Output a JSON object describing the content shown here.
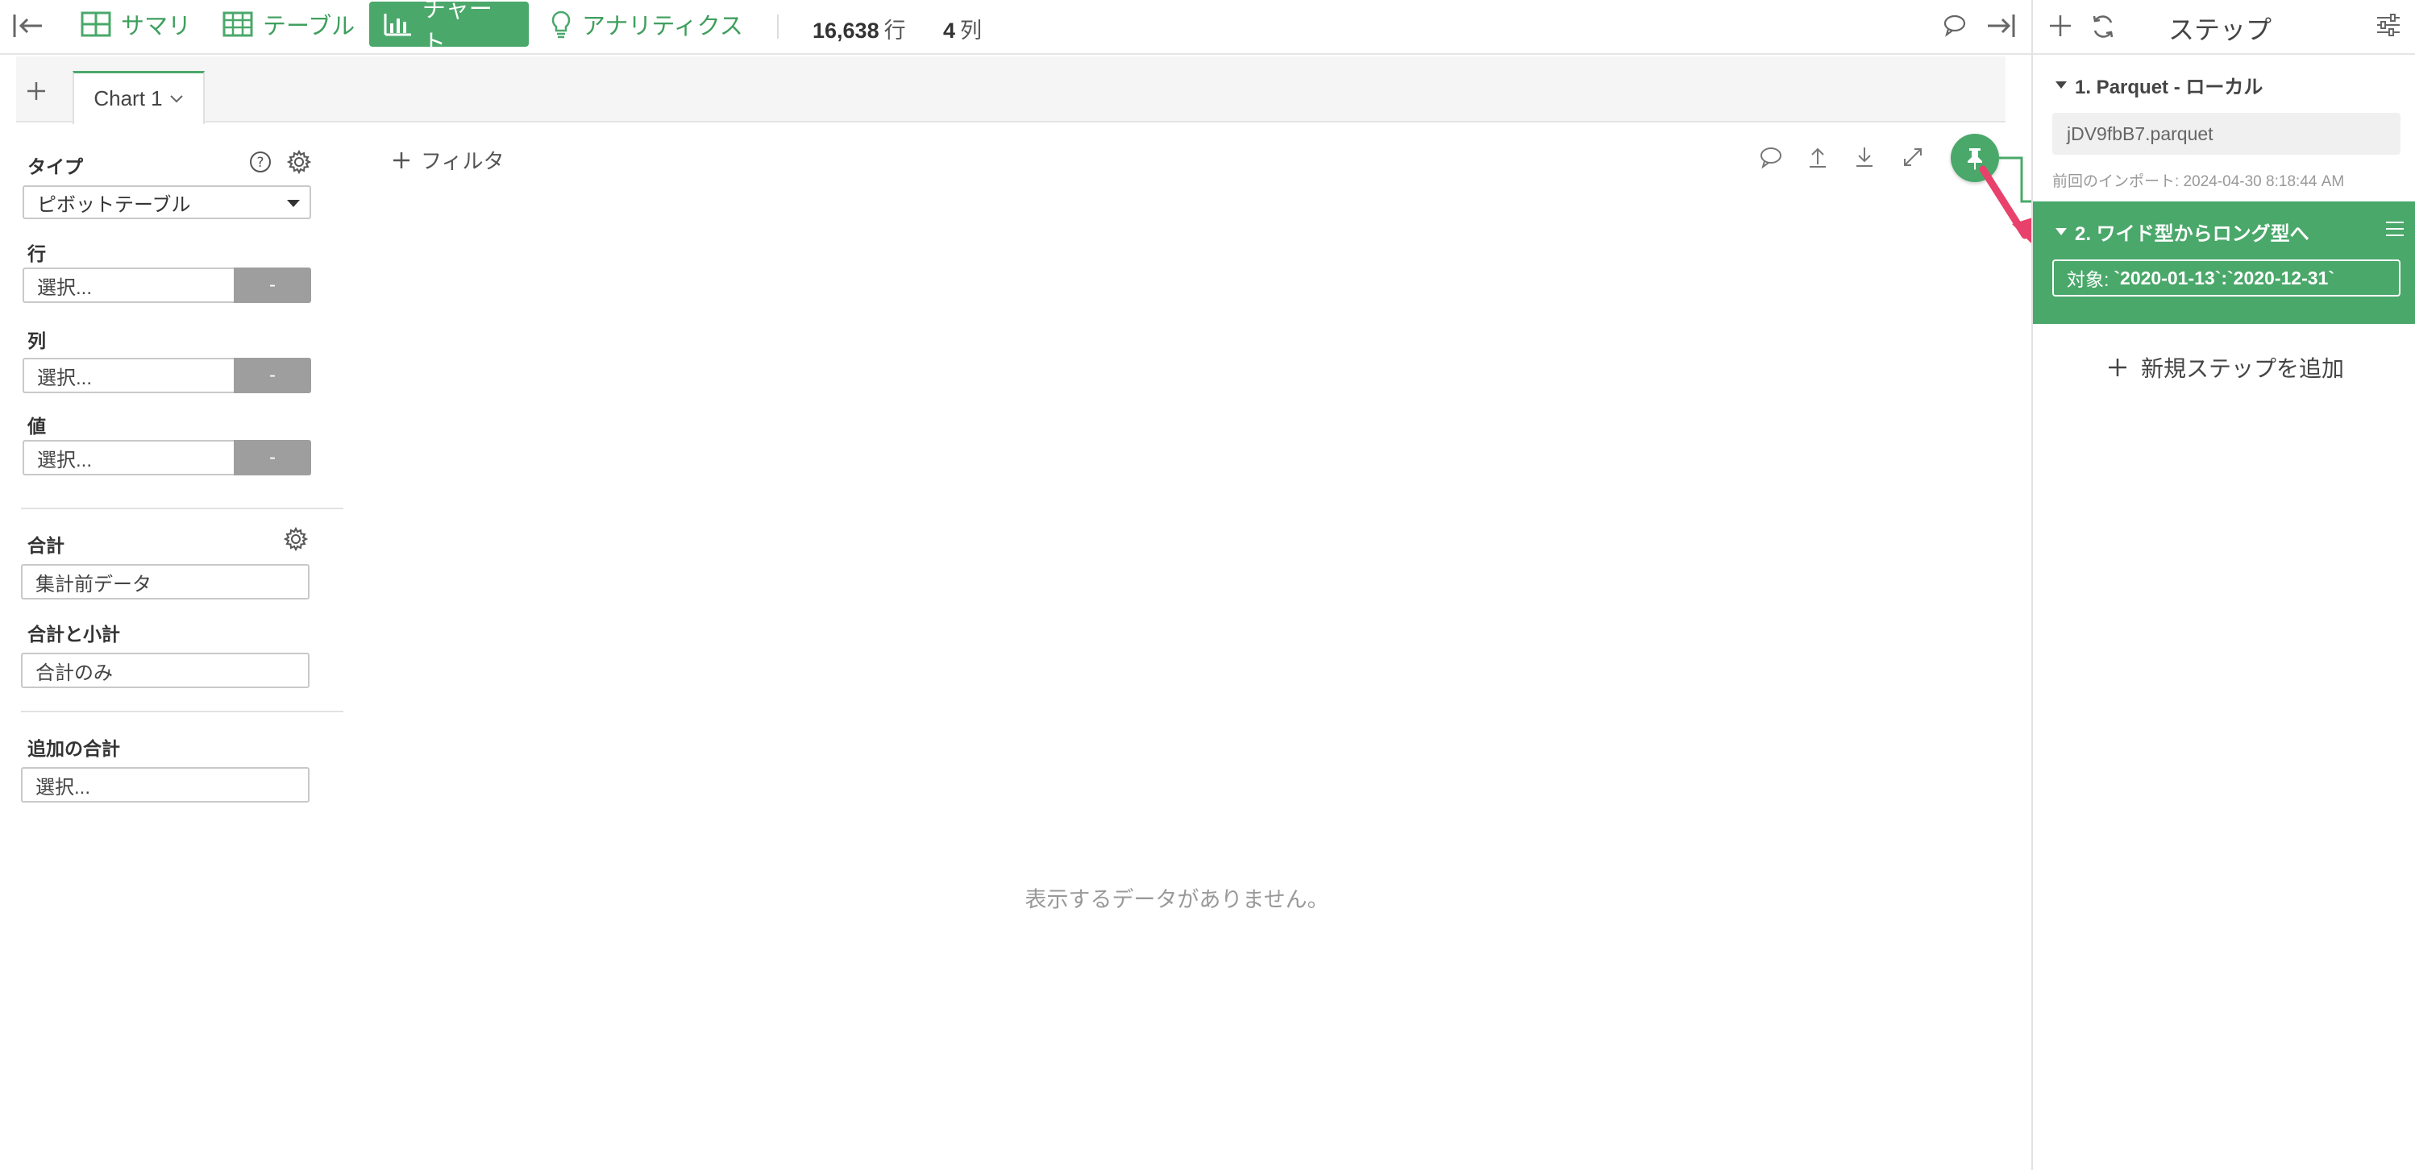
{
  "topbar": {
    "tabs": [
      {
        "label": "サマリ",
        "icon": "grid-icon"
      },
      {
        "label": "テーブル",
        "icon": "table-icon"
      },
      {
        "label": "チャート",
        "icon": "bar-chart-icon",
        "active": true
      },
      {
        "label": "アナリティクス",
        "icon": "lightbulb-icon"
      }
    ],
    "rows_count": "16,638",
    "rows_unit": "行",
    "cols_count": "4",
    "cols_unit": "列"
  },
  "chart_tabs": {
    "current": "Chart 1"
  },
  "config": {
    "type_label": "タイプ",
    "type_value": "ピボットテーブル",
    "rows_label": "行",
    "rows_placeholder": "選択...",
    "cols_label": "列",
    "cols_placeholder": "選択...",
    "values_label": "値",
    "values_placeholder": "選択...",
    "dash": "-",
    "total_label": "合計",
    "total_value": "集計前データ",
    "subtotal_label": "合計と小計",
    "subtotal_value": "合計のみ",
    "extra_total_label": "追加の合計",
    "extra_total_placeholder": "選択..."
  },
  "chart_area": {
    "filter_label": "フィルタ",
    "empty_message": "表示するデータがありません。"
  },
  "steps_panel": {
    "title": "ステップ",
    "step1": {
      "title": "1. Parquet - ローカル",
      "file": "jDV9fbB7.parquet",
      "meta": "前回のインポート: 2024-04-30 8:18:44 AM"
    },
    "step2": {
      "title": "2. ワイド型からロング型へ",
      "target_prefix": "対象:",
      "target_value": "`2020-01-13`:`2020-12-31`"
    },
    "add_step": "新規ステップを追加"
  },
  "colors": {
    "accent": "#4aa86a",
    "arrow": "#e8416b",
    "button_gray": "#9e9e9e"
  }
}
